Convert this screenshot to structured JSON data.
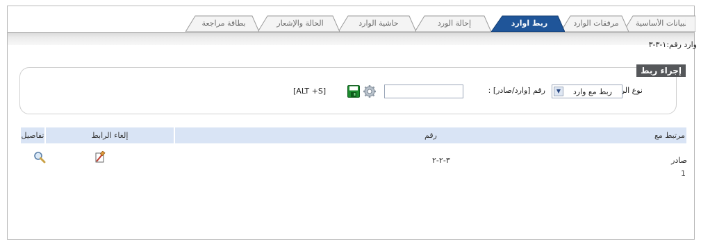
{
  "tabs": [
    {
      "label": "البيانات الأساسية",
      "active": false
    },
    {
      "label": "مرفقات الوارد",
      "active": false
    },
    {
      "label": "ربط اوارد",
      "active": true
    },
    {
      "label": "إحالة الورد",
      "active": false
    },
    {
      "label": "حاشية الوارد",
      "active": false
    },
    {
      "label": "الحالة والإشعار",
      "active": false
    },
    {
      "label": "بطاقة مراجعة",
      "active": false
    }
  ],
  "incoming_label": "وارد رقم:١-٣-٣",
  "link_group": {
    "legend": "إجراء ربط",
    "link_type_label": "نوع الربط :",
    "link_type_value": "ربط مع وارد",
    "number_label": "رقم [وارد/صادر] :",
    "number_value": "",
    "shortcut": "[ALT +S]"
  },
  "table": {
    "headers": {
      "linked_with": "مرتبط مع",
      "number": "رقم",
      "unlink": "إلغاء الرابط",
      "details": "تفاصيل"
    },
    "rows": [
      {
        "linked_with": "صادر",
        "number": "٣-٢-٢"
      }
    ],
    "count": "1"
  },
  "colors": {
    "active_tab": "#1f5599",
    "header_bg": "#d9e4f5",
    "legend_bg": "#55575a"
  }
}
